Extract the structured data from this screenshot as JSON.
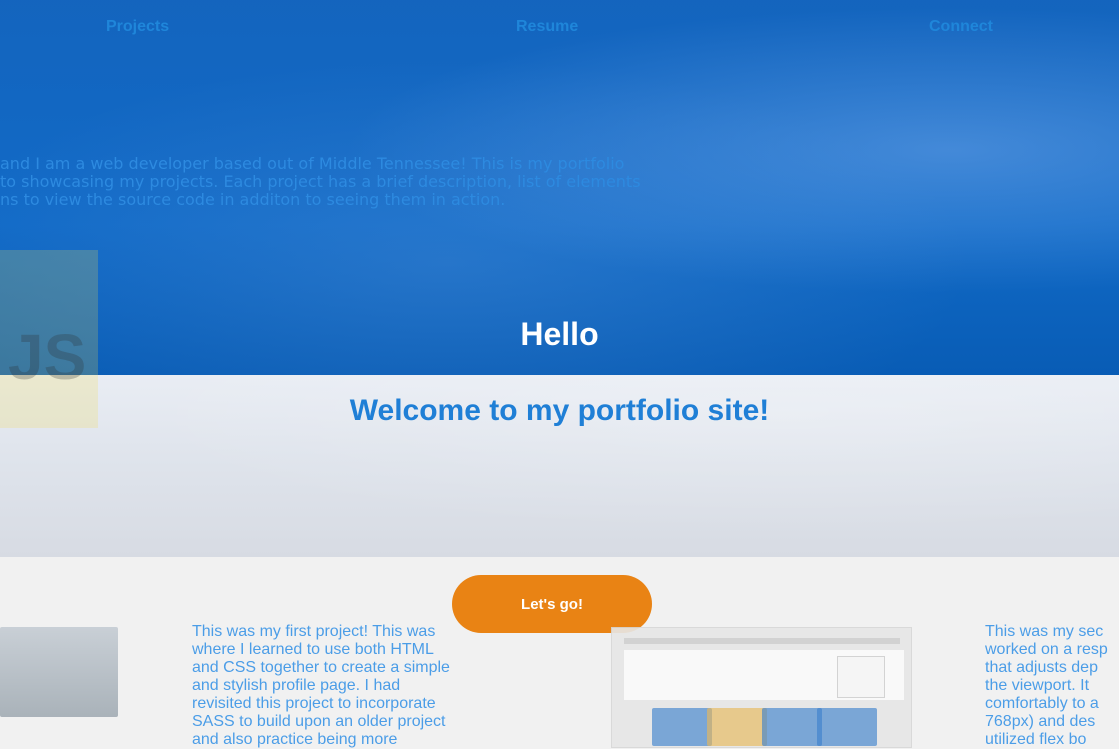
{
  "nav": {
    "projects": "Projects",
    "resume": "Resume",
    "connect": "Connect"
  },
  "intro": {
    "lines": [
      "and I am a web developer based out of Middle Tennessee! This is my portfolio",
      "to showcasing my projects. Each project has a brief description, list of elements",
      "ns to view the source code in additon to seeing them in action."
    ]
  },
  "hero": {
    "hello": "Hello",
    "welcome": "Welcome to my portfolio site!",
    "cta_label": "Let's go!",
    "logo_text": "JS"
  },
  "projects": {
    "project1_desc": [
      "This was my first project! This was",
      "where I learned to use both HTML",
      "and CSS together to create a simple",
      "and stylish profile page. I had",
      "revisited this project to incorporate",
      "SASS to build upon an older project",
      "and also practice being more"
    ],
    "project2_desc": [
      "This was my sec",
      "worked on a resp",
      "that adjusts dep",
      "the viewport. It",
      "comfortably to a",
      "768px) and des",
      "utilized flex bo"
    ]
  },
  "colors": {
    "primary_blue": "#0b6fbf",
    "accent_orange": "#e98314"
  }
}
